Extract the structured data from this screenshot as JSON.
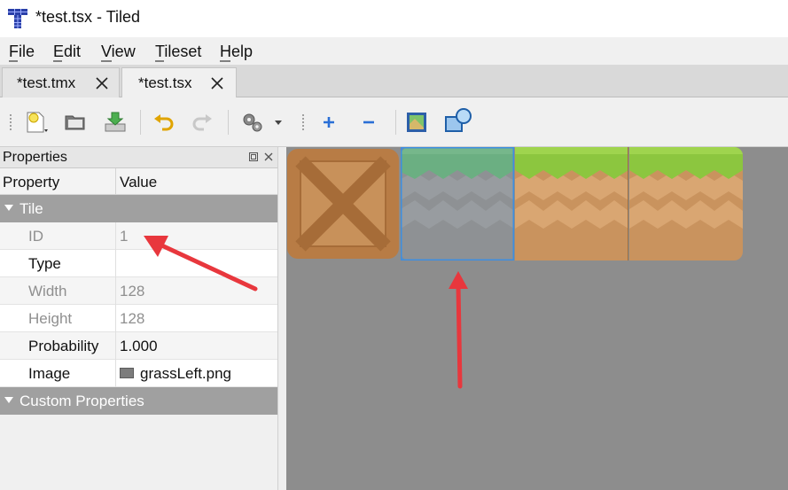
{
  "window": {
    "title": "*test.tsx - Tiled",
    "app_icon": "tiled-app-icon"
  },
  "menu": {
    "items": [
      {
        "label": "File",
        "mnemonic": "F"
      },
      {
        "label": "Edit",
        "mnemonic": "E"
      },
      {
        "label": "View",
        "mnemonic": "V"
      },
      {
        "label": "Tileset",
        "mnemonic": "T"
      },
      {
        "label": "Help",
        "mnemonic": "H"
      }
    ]
  },
  "tabs": [
    {
      "label": "*test.tmx",
      "active": false,
      "close_icon": "close-icon"
    },
    {
      "label": "*test.tsx",
      "active": true,
      "close_icon": "close-icon"
    }
  ],
  "toolbar": {
    "tools": [
      {
        "icon": "new-tileset-icon",
        "enabled": true
      },
      {
        "icon": "open-folder-icon",
        "enabled": true
      },
      {
        "icon": "save-icon",
        "enabled": true
      },
      {
        "icon": "undo-icon",
        "enabled": true
      },
      {
        "icon": "redo-icon",
        "enabled": false
      },
      {
        "icon": "settings-dropdown-icon",
        "enabled": true
      },
      {
        "icon": "add-tiles-icon",
        "enabled": true
      },
      {
        "icon": "remove-tiles-icon",
        "enabled": true
      },
      {
        "icon": "edit-terrain-icon",
        "enabled": true
      },
      {
        "icon": "edit-collision-icon",
        "enabled": true
      }
    ]
  },
  "properties_panel": {
    "title": "Properties",
    "columns": {
      "property": "Property",
      "value": "Value"
    },
    "group_tile": "Tile",
    "rows": [
      {
        "name": "ID",
        "value": "1",
        "read_only": true
      },
      {
        "name": "Type",
        "value": "",
        "read_only": false
      },
      {
        "name": "Width",
        "value": "128",
        "read_only": true
      },
      {
        "name": "Height",
        "value": "128",
        "read_only": true
      },
      {
        "name": "Probability",
        "value": "1.000",
        "read_only": false
      },
      {
        "name": "Image",
        "value": "grassLeft.png",
        "read_only": false
      }
    ],
    "group_custom": "Custom Properties"
  },
  "tileset": {
    "tiles": [
      {
        "name": "crate",
        "selected": false
      },
      {
        "name": "grassLeft",
        "selected": true
      },
      {
        "name": "grassMid",
        "selected": false
      },
      {
        "name": "grassRight",
        "selected": false
      }
    ],
    "colors": {
      "background": "#8d8d8d",
      "selection": "#3d8ee0",
      "grass": "#8cc63f",
      "dirt": "#c9935e",
      "crate": "#b87c45"
    }
  },
  "annotations": {
    "arrow_color": "#e8373d"
  }
}
